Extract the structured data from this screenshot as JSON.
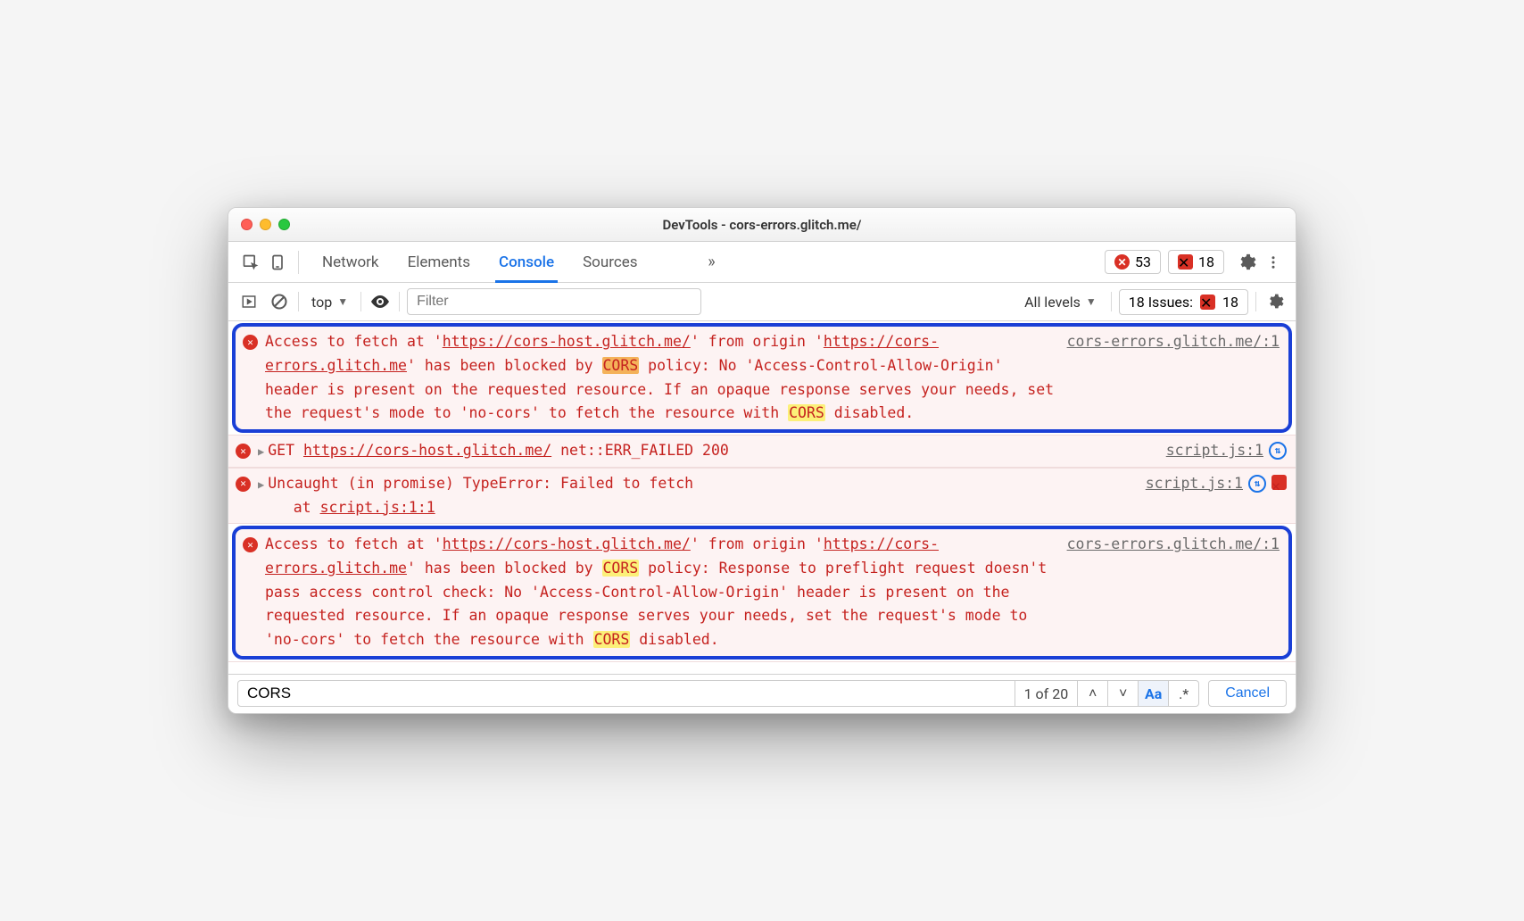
{
  "window": {
    "title": "DevTools - cors-errors.glitch.me/"
  },
  "panelTabs": {
    "items": [
      "Network",
      "Elements",
      "Console",
      "Sources"
    ],
    "activeIndex": 2,
    "overflow": "»"
  },
  "counters": {
    "errors": 53,
    "issues": 18
  },
  "toolbar": {
    "context": "top",
    "filterPlaceholder": "Filter",
    "levels": "All levels",
    "issuesLabel": "18 Issues:",
    "issuesCount": 18
  },
  "messages": [
    {
      "type": "error",
      "boxed": true,
      "source": "cors-errors.glitch.me/:1",
      "segments": [
        {
          "t": "Access to fetch at '"
        },
        {
          "t": "https://cors-host.glitch.me/",
          "ul": true
        },
        {
          "t": "' from origin '"
        },
        {
          "t": "https://cors-errors.glitch.me",
          "ul": true
        },
        {
          "t": "' has been blocked by "
        },
        {
          "t": "CORS",
          "hl": "o"
        },
        {
          "t": " policy: No 'Access-Control-Allow-Origin' header is present on the requested resource. If an opaque response serves your needs, set the request's mode to 'no-cors' to fetch the resource with "
        },
        {
          "t": "CORS",
          "hl": "y"
        },
        {
          "t": " disabled."
        }
      ]
    },
    {
      "type": "error",
      "disclosure": true,
      "refresh": true,
      "source": "script.js:1",
      "segments": [
        {
          "t": "GET "
        },
        {
          "t": "https://cors-host.glitch.me/",
          "ul": true
        },
        {
          "t": " net::ERR_FAILED 200"
        }
      ]
    },
    {
      "type": "error",
      "disclosure": true,
      "refresh": true,
      "issue": true,
      "source": "script.js:1",
      "segments": [
        {
          "t": "Uncaught (in promise) TypeError: Failed to fetch"
        },
        {
          "t": "\n    at "
        },
        {
          "t": "script.js:1:1",
          "ul": true
        }
      ]
    },
    {
      "type": "error",
      "boxed": true,
      "source": "cors-errors.glitch.me/:1",
      "segments": [
        {
          "t": "Access to fetch at '"
        },
        {
          "t": "https://cors-host.glitch.me/",
          "ul": true
        },
        {
          "t": "' from origin '"
        },
        {
          "t": "https://cors-errors.glitch.me",
          "ul": true
        },
        {
          "t": "' has been blocked by "
        },
        {
          "t": "CORS",
          "hl": "y"
        },
        {
          "t": " policy: Response to preflight request doesn't pass access control check: No 'Access-Control-Allow-Origin' header is present on the requested resource. If an opaque response serves your needs, set the request's mode to 'no-cors' to fetch the resource with "
        },
        {
          "t": "CORS",
          "hl": "y"
        },
        {
          "t": " disabled."
        }
      ]
    }
  ],
  "find": {
    "query": "CORS",
    "status": "1 of 20",
    "caseLabel": "Aa",
    "regexLabel": ".*",
    "cancel": "Cancel"
  }
}
